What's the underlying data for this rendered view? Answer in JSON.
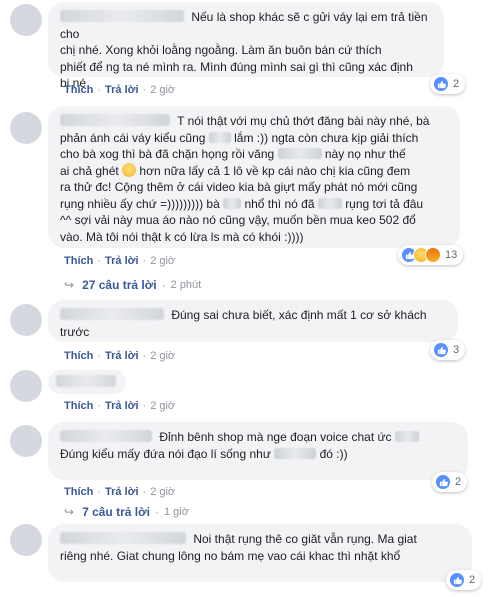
{
  "comments": [
    {
      "text_lines": [
        "Nếu là shop khác sẽ c gửi váy lại em trả tiền cho",
        "chị nhé. Xong khỏi loằng ngoằng. Làm ăn buôn bán cứ thích",
        "phiết để ng ta né mình ra. Mình đúng mình sai gì thì cũng xác định",
        "bị né"
      ],
      "reaction_count": "2",
      "like": "Thích",
      "reply": "Trả lời",
      "time": "2 giờ"
    },
    {
      "text_lines": [
        "T nói thật với mụ chủ thớt đăng bài này nhé, bà",
        "phản ánh cái váy kiểu cũng",
        "lắm :)) ngta còn chưa kịp giải thích",
        "cho bà xog thì bà đã chặn họng rồi văng",
        "này nọ như thế",
        "ai chả ghét",
        "hơn nữa lấy cả 1 lô về kp cái nào chị kia cũng đem",
        "ra thử đc! Cộng thêm ở cái video kia bà giựt mấy phát nó mới cũng",
        "rụng nhiều ấy chứ =))))))))) bà",
        "nhổ thì nó đã",
        "rụng tơi tả đâu",
        "^^ sợi vải này mua áo nào nó cũng vậy, muốn bền mua keo 502 đổ",
        "vào. Mà tôi nói thật k có lừa ls mà có khói :))))"
      ],
      "reaction_count": "13",
      "like": "Thích",
      "reply": "Trả lời",
      "time": "2 giờ",
      "replies_label": "27 câu trả lời",
      "replies_time": "2 phút"
    },
    {
      "text_lines": [
        "Đúng sai chưa biết, xác định mất 1 cơ sở khách",
        "trước"
      ],
      "reaction_count": "3",
      "like": "Thích",
      "reply": "Trả lời",
      "time": "2 giờ"
    },
    {
      "like": "Thích",
      "reply": "Trả lời",
      "time": "2 giờ"
    },
    {
      "text_lines": [
        "Đỉnh bênh shop mà nge đoạn voice chat ức",
        "Đúng kiểu mấy đứa nói đạo lí sống như",
        "đó :))"
      ],
      "reaction_count": "2",
      "like": "Thích",
      "reply": "Trả lời",
      "time": "2 giờ",
      "replies_label": "7 câu trả lời",
      "replies_time": "1 giờ"
    },
    {
      "text_lines": [
        "Noi thật rụng thê co giăt vẫn rụng. Ma giat",
        "riêng nhé. Giat chung lông no bám mẹ vao cái khac thì nhặt khổ"
      ],
      "reaction_count": "2"
    }
  ],
  "colors": {
    "link": "#385898",
    "meta": "#90949c",
    "bubble": "#f2f3f5",
    "like": "#5890ff"
  }
}
